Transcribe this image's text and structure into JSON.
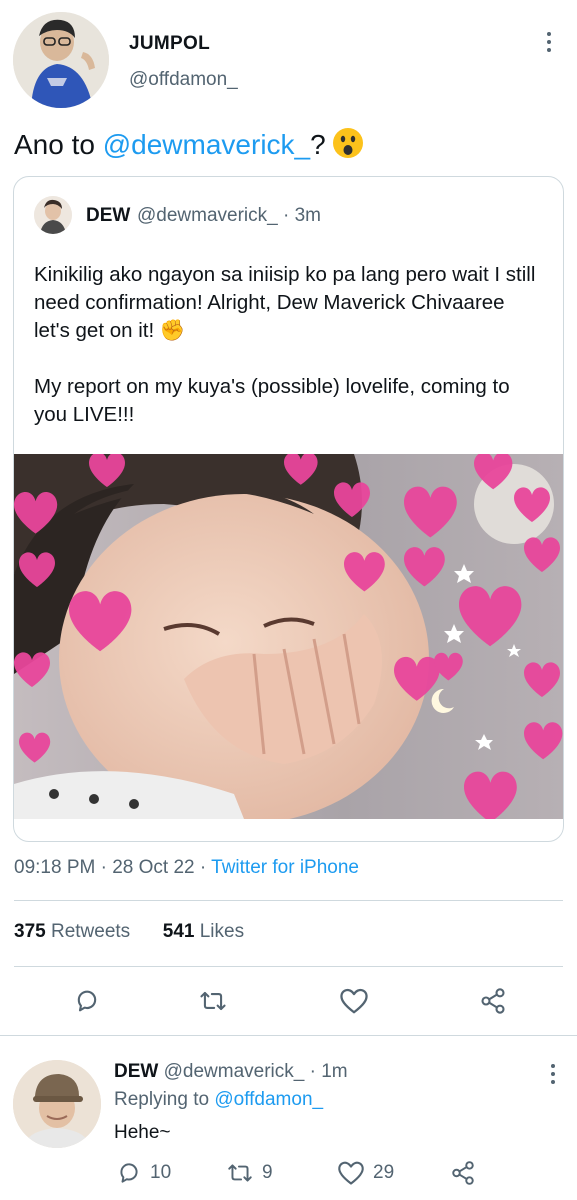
{
  "tweet": {
    "author_name": "JUMPOL",
    "author_handle": "@offdamon_",
    "text_prefix": "Ano to ",
    "mention": "@dewmaverick_",
    "text_suffix": "?",
    "timestamp": "09:18 PM · 28 Oct 22 · ",
    "source": "Twitter for iPhone",
    "retweets_count": "375",
    "retweets_label": " Retweets",
    "likes_count": "541",
    "likes_label": " Likes"
  },
  "quote": {
    "name": "DEW",
    "handle_time": "@dewmaverick_ · 3m",
    "paragraph1": "Kinikilig ako ngayon sa iniisip ko pa lang pero wait I still need confirmation! Alright, Dew Maverick Chivaaree let's get on it! ✊",
    "paragraph2": "My report on my kuya's (possible) lovelife, coming to you LIVE!!!"
  },
  "reply": {
    "name": "DEW",
    "handle_time": " @dewmaverick_ · 1m",
    "replying_label": "Replying to ",
    "replying_to": "@offdamon_",
    "text": "Hehe~",
    "reply_count": "10",
    "retweet_count": "9",
    "like_count": "29"
  },
  "icons": {
    "reply": "reply-icon",
    "retweet": "retweet-icon",
    "like": "heart-icon",
    "share": "share-icon",
    "more": "more-vertical-icon"
  },
  "colors": {
    "accent": "#1d9bf0",
    "secondary_text": "#536471",
    "border": "#cfd9de"
  }
}
